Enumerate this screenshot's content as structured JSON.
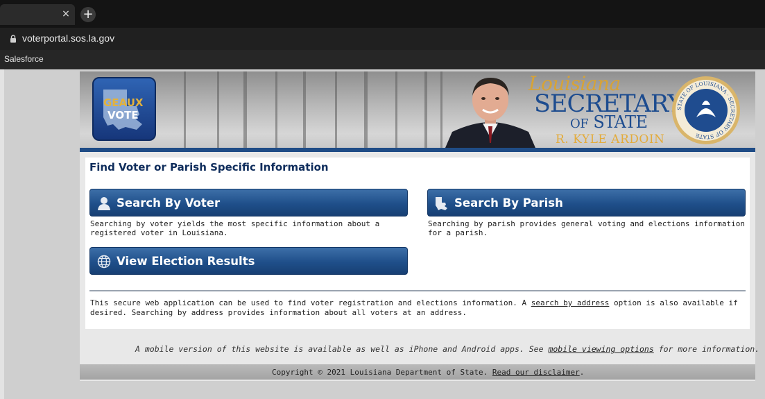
{
  "browser": {
    "tab_close": "×",
    "new_tab": "+",
    "url": "voterportal.sos.la.gov",
    "bookmark": "Salesforce"
  },
  "header": {
    "logo_line1": "GEAUX",
    "logo_line2": "VOTE",
    "title_louisiana": "Louisiana",
    "title_secretary": "SECRETARY",
    "title_of": "OF",
    "title_state": "STATE",
    "title_name": "R. KYLE ARDOIN",
    "seal_text": "STATE OF LOUISIANA · SECRETARY OF STATE"
  },
  "main": {
    "heading": "Find Voter or Parish Specific Information",
    "search_voter": {
      "label": "Search By Voter",
      "icon": "person-icon",
      "description": "Searching by voter yields the most specific information about a registered voter in Louisiana."
    },
    "search_parish": {
      "label": "Search By Parish",
      "icon": "louisiana-map-icon",
      "description": "Searching by parish provides general voting and elections information for a parish."
    },
    "election_results": {
      "label": "View Election Results",
      "icon": "globe-icon"
    },
    "info_before": "This secure web application can be used to find voter registration and elections information. A ",
    "info_link": "search by address",
    "info_after": " option is also available if desired. Searching by address provides information about all voters at an address."
  },
  "footer": {
    "mobile_before": "A mobile version of this website is available as well as iPhone and Android apps. See ",
    "mobile_link": "mobile viewing options",
    "mobile_after": " for more information.",
    "copyright": "Copyright © 2021 Louisiana Department of State. ",
    "disclaimer_link": "Read our disclaimer",
    "disclaimer_end": "."
  }
}
